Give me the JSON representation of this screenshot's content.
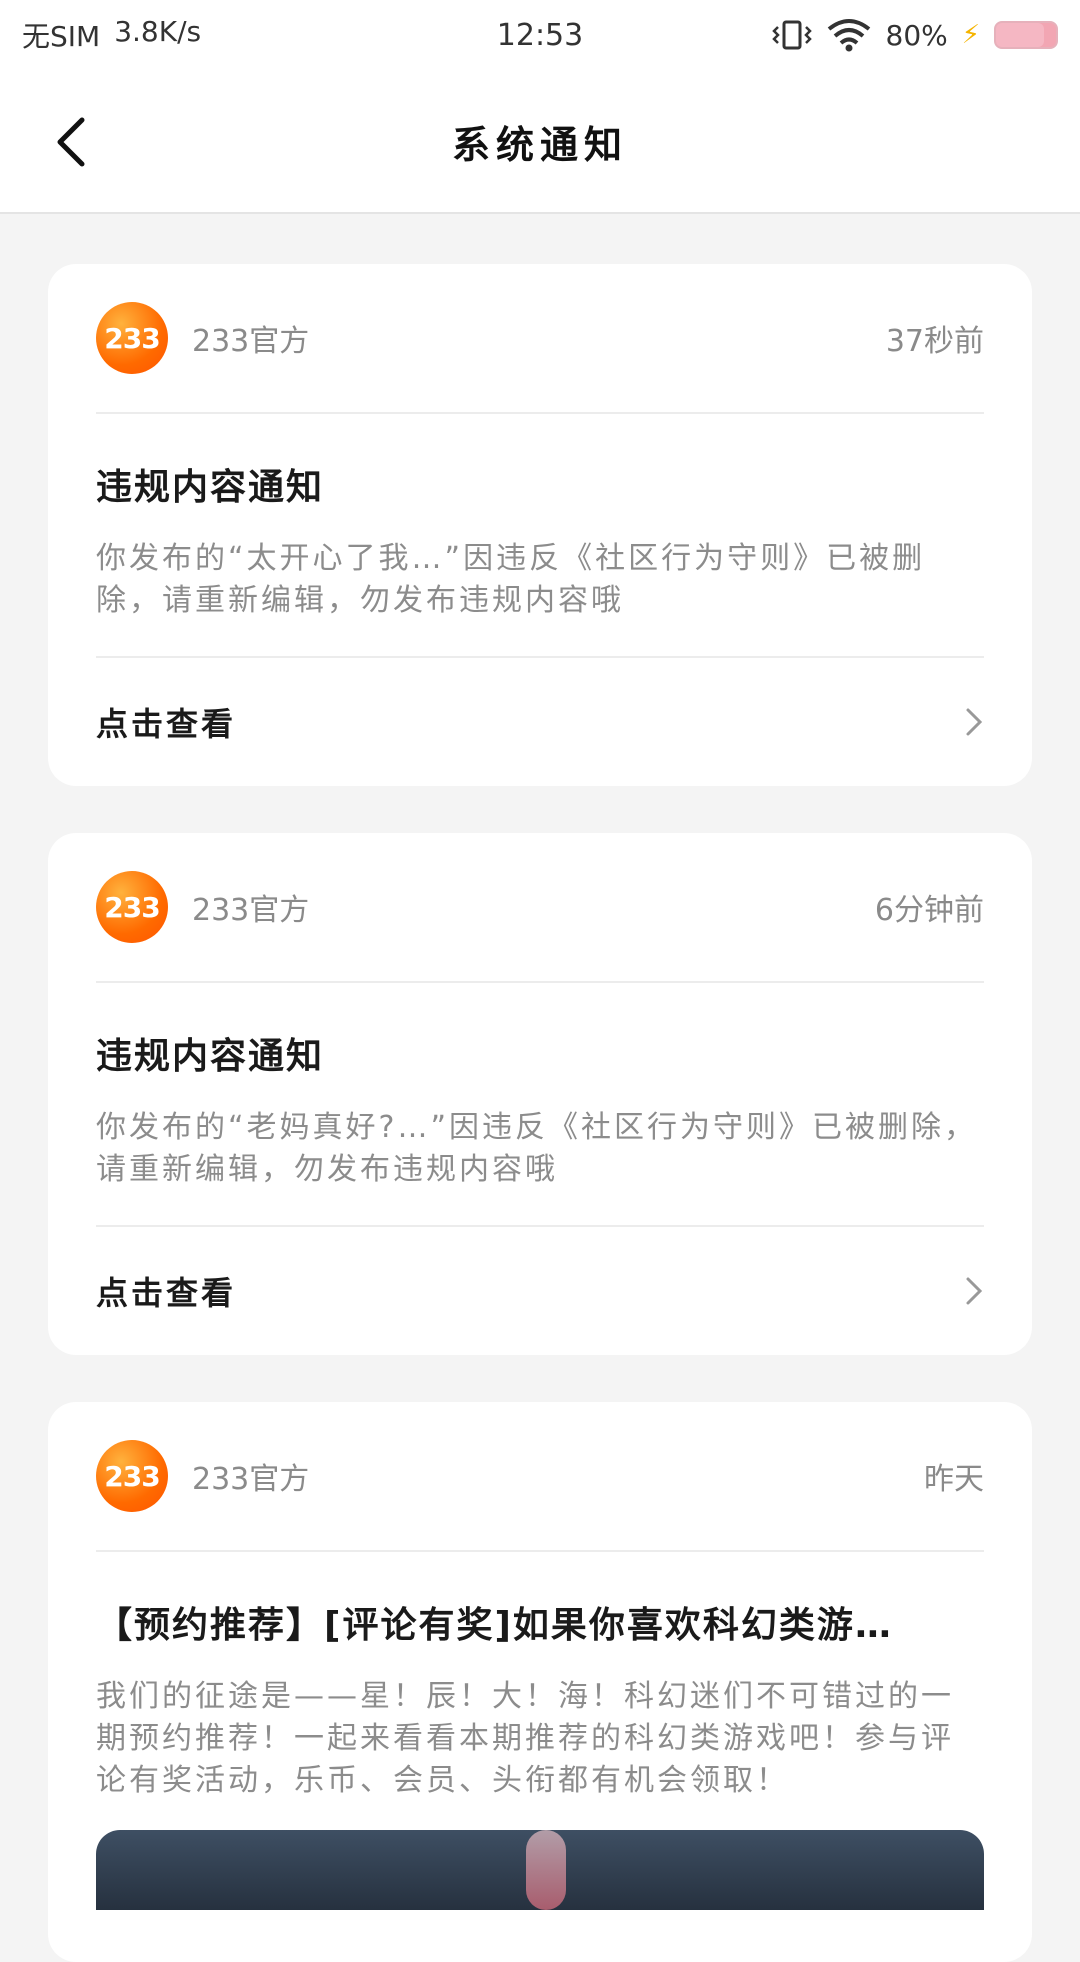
{
  "status_bar": {
    "carrier": "无SIM",
    "speed": "3.8K/s",
    "time": "12:53",
    "battery": "80%",
    "battery_level": 0.8
  },
  "header": {
    "title": "系统通知"
  },
  "notifications": [
    {
      "sender": "233官方",
      "logo_text": "233",
      "time": "37秒前",
      "title": "违规内容通知",
      "text": "你发布的“太开心了我…”因违反《社区行为守则》已被删除，请重新编辑，勿发布违规内容哦",
      "action": "点击查看"
    },
    {
      "sender": "233官方",
      "logo_text": "233",
      "time": "6分钟前",
      "title": "违规内容通知",
      "text": "你发布的“老妈真好?…”因违反《社区行为守则》已被删除，请重新编辑，勿发布违规内容哦",
      "action": "点击查看"
    },
    {
      "sender": "233官方",
      "logo_text": "233",
      "time": "昨天",
      "title": "【预约推荐】[评论有奖]如果你喜欢科幻类游…",
      "text": "我们的征途是——星！辰！大！海！科幻迷们不可错过的一期预约推荐！一起来看看本期推荐的科幻类游戏吧！参与评论有奖活动，乐币、会员、头衔都有机会领取！"
    }
  ],
  "colors": {
    "accent": "#ff6a00",
    "background": "#f4f4f4",
    "card": "#ffffff"
  }
}
